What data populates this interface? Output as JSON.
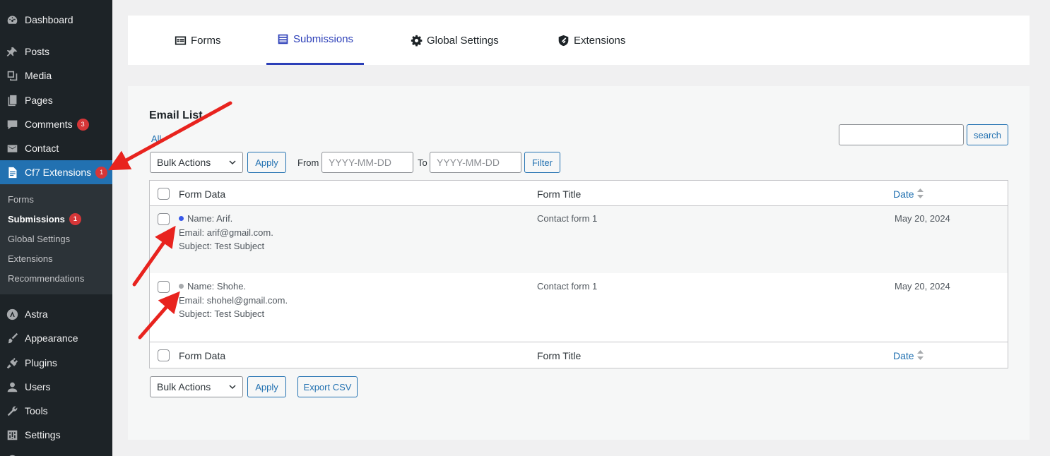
{
  "sidebar": {
    "items": [
      {
        "label": "Dashboard",
        "icon": "dashboard-icon"
      },
      {
        "label": "Posts",
        "icon": "pin-icon"
      },
      {
        "label": "Media",
        "icon": "media-icon"
      },
      {
        "label": "Pages",
        "icon": "pages-icon"
      },
      {
        "label": "Comments",
        "icon": "comment-icon",
        "badge": "3"
      },
      {
        "label": "Contact",
        "icon": "mail-icon"
      },
      {
        "label": "Cf7 Extensions",
        "icon": "document-icon",
        "badge": "1"
      },
      {
        "label": "Astra",
        "icon": "astra-icon"
      },
      {
        "label": "Appearance",
        "icon": "brush-icon"
      },
      {
        "label": "Plugins",
        "icon": "plug-icon"
      },
      {
        "label": "Users",
        "icon": "user-icon"
      },
      {
        "label": "Tools",
        "icon": "wrench-icon"
      },
      {
        "label": "Settings",
        "icon": "settings-icon"
      }
    ],
    "submenu": [
      {
        "label": "Forms"
      },
      {
        "label": "Submissions",
        "badge": "1"
      },
      {
        "label": "Global Settings"
      },
      {
        "label": "Extensions"
      },
      {
        "label": "Recommendations"
      }
    ]
  },
  "tabs": [
    {
      "label": "Forms",
      "icon": "form-icon"
    },
    {
      "label": "Submissions",
      "icon": "list-icon"
    },
    {
      "label": "Global Settings",
      "icon": "gear-icon"
    },
    {
      "label": "Extensions",
      "icon": "extension-icon"
    }
  ],
  "main": {
    "title": "Email List",
    "all_link": "All",
    "search": {
      "value": "",
      "button": "search"
    },
    "top_toolbar": {
      "bulk_actions": "Bulk Actions",
      "apply": "Apply",
      "from_label": "From",
      "from_placeholder": "YYYY-MM-DD",
      "to_label": "To",
      "to_placeholder": "YYYY-MM-DD",
      "filter": "Filter"
    },
    "table": {
      "columns": [
        "Form Data",
        "Form Title",
        "Date"
      ],
      "rows": [
        {
          "name": "Name: Arif.",
          "email": "Email: arif@gmail.com.",
          "subject": "Subject: Test Subject",
          "form_title": "Contact form 1",
          "date": "May 20, 2024",
          "unread": true
        },
        {
          "name": "Name: Shohe.",
          "email": "Email: shohel@gmail.com.",
          "subject": "Subject: Test Subject",
          "form_title": "Contact form 1",
          "date": "May 20, 2024",
          "unread": false
        }
      ]
    },
    "bottom_toolbar": {
      "bulk_actions": "Bulk Actions",
      "apply": "Apply",
      "export": "Export CSV"
    }
  },
  "colors": {
    "sidebar_bg": "#1d2327",
    "accent": "#2271b1",
    "active_tab": "#2c3fb8",
    "badge": "#d63638",
    "arrow": "#e8231e",
    "unread_dot": "#3858e9",
    "read_dot": "#a7aaad"
  }
}
